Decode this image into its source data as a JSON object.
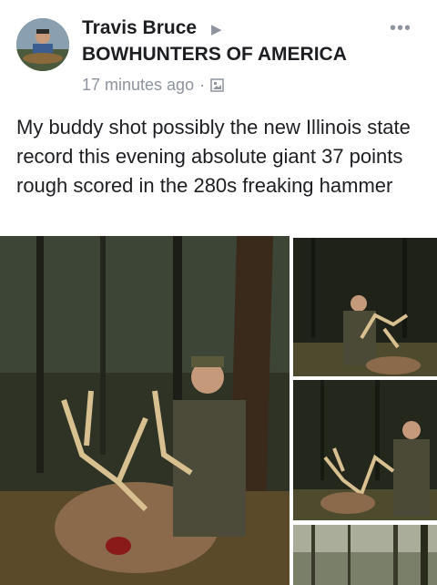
{
  "post": {
    "author": "Travis Bruce",
    "group": "BOWHUNTERS OF AMERICA",
    "time": "17 minutes ago",
    "separator": "·",
    "text": "My buddy shot possibly the new Illinois state record this evening absolute giant 37 points rough scored in the 280s freaking hammer"
  },
  "icons": {
    "arrow": "triangle-right-icon",
    "privacy": "image-icon",
    "more": "more-options-icon"
  }
}
